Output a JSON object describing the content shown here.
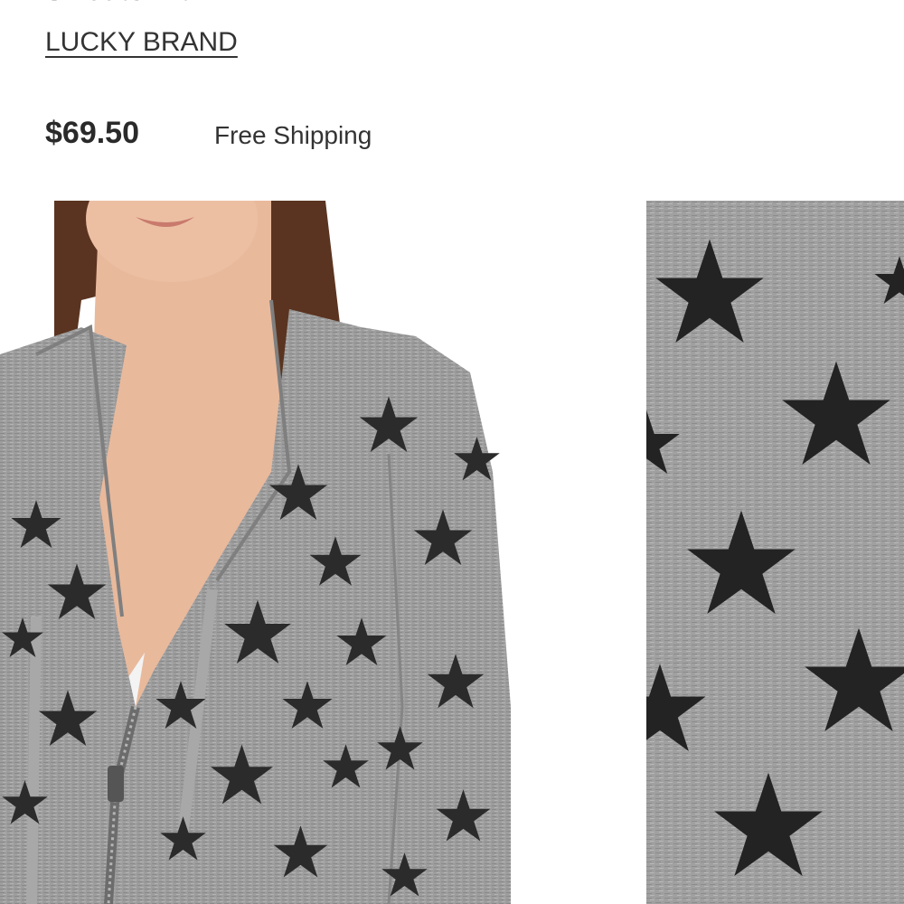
{
  "product": {
    "title_partial": "Sweatshirt",
    "brand": "LUCKY BRAND",
    "price": "$69.50",
    "shipping": "Free Shipping"
  },
  "colors": {
    "fabric": "#9b9b9b",
    "star": "#2b2b2b",
    "skin": "#e9b99c",
    "hair": "#5a3420"
  },
  "gallery": {
    "main_image": "product-photo-star-print-zip-hoodie",
    "detail_image": "fabric-closeup-star-print"
  }
}
